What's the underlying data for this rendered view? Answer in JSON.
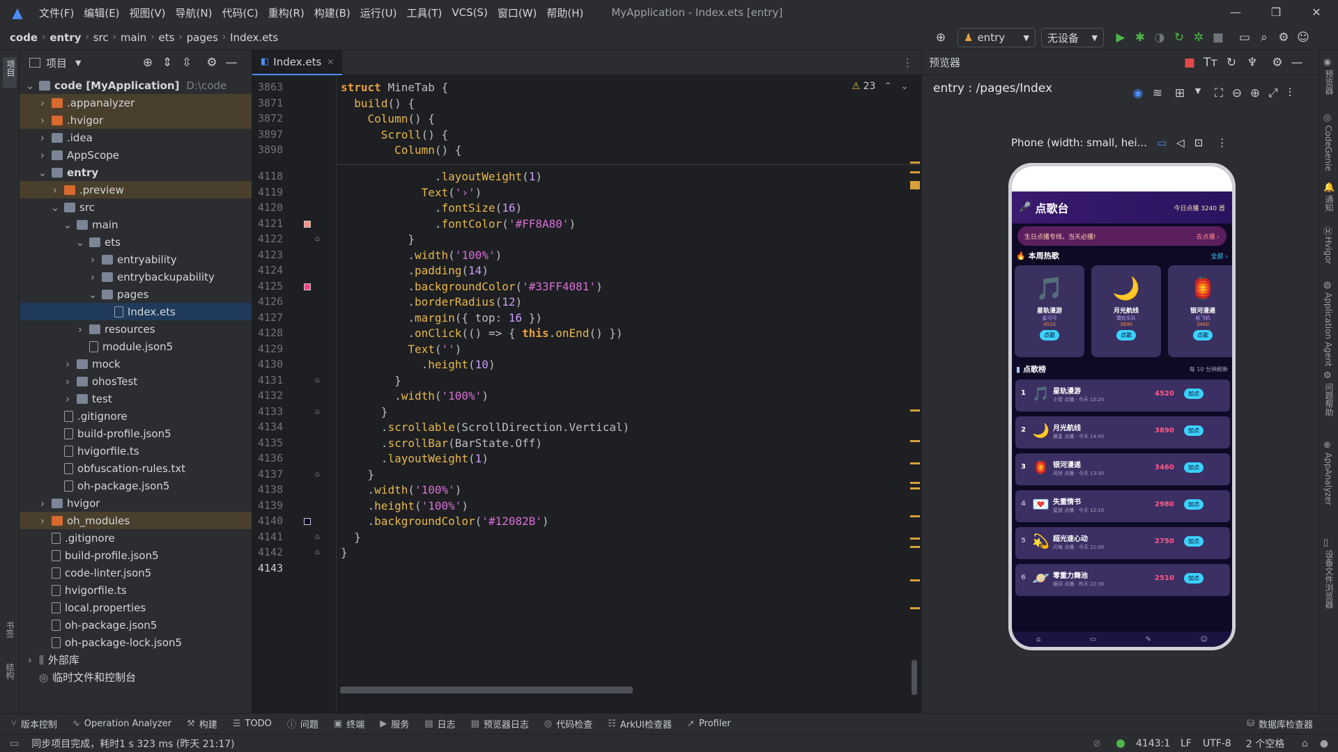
{
  "menubar": {
    "items": [
      "文件(F)",
      "编辑(E)",
      "视图(V)",
      "导航(N)",
      "代码(C)",
      "重构(R)",
      "构建(B)",
      "运行(U)",
      "工具(T)",
      "VCS(S)",
      "窗口(W)",
      "帮助(H)"
    ],
    "title": "MyApplication - Index.ets [entry]"
  },
  "breadcrumb": [
    "code",
    "entry",
    "src",
    "main",
    "ets",
    "pages",
    "Index.ets"
  ],
  "toolbar": {
    "run_config": "entry",
    "device": "无设备"
  },
  "project_panel": {
    "title": "项目"
  },
  "tree": [
    {
      "label": "code [MyApplication]",
      "path": "D:\\code",
      "depth": 0,
      "chev": "v",
      "icon": "folder",
      "hl": false,
      "bold": true
    },
    {
      "label": ".appanalyzer",
      "depth": 1,
      "chev": ">",
      "icon": "folder-or",
      "hl": true
    },
    {
      "label": ".hvigor",
      "depth": 1,
      "chev": ">",
      "icon": "folder-or",
      "hl": true
    },
    {
      "label": ".idea",
      "depth": 1,
      "chev": ">",
      "icon": "folder"
    },
    {
      "label": "AppScope",
      "depth": 1,
      "chev": ">",
      "icon": "folder"
    },
    {
      "label": "entry",
      "depth": 1,
      "chev": "v",
      "icon": "folder",
      "bold": true
    },
    {
      "label": ".preview",
      "depth": 2,
      "chev": ">",
      "icon": "folder-or",
      "hl": true
    },
    {
      "label": "src",
      "depth": 2,
      "chev": "v",
      "icon": "folder"
    },
    {
      "label": "main",
      "depth": 3,
      "chev": "v",
      "icon": "folder"
    },
    {
      "label": "ets",
      "depth": 4,
      "chev": "v",
      "icon": "folder"
    },
    {
      "label": "entryability",
      "depth": 5,
      "chev": ">",
      "icon": "folder"
    },
    {
      "label": "entrybackupability",
      "depth": 5,
      "chev": ">",
      "icon": "folder"
    },
    {
      "label": "pages",
      "depth": 5,
      "chev": "v",
      "icon": "folder"
    },
    {
      "label": "Index.ets",
      "depth": 6,
      "chev": "",
      "icon": "file",
      "sel": true
    },
    {
      "label": "resources",
      "depth": 4,
      "chev": ">",
      "icon": "folder"
    },
    {
      "label": "module.json5",
      "depth": 4,
      "chev": "",
      "icon": "file"
    },
    {
      "label": "mock",
      "depth": 3,
      "chev": ">",
      "icon": "folder"
    },
    {
      "label": "ohosTest",
      "depth": 3,
      "chev": ">",
      "icon": "folder"
    },
    {
      "label": "test",
      "depth": 3,
      "chev": ">",
      "icon": "folder"
    },
    {
      "label": ".gitignore",
      "depth": 2,
      "chev": "",
      "icon": "file"
    },
    {
      "label": "build-profile.json5",
      "depth": 2,
      "chev": "",
      "icon": "file"
    },
    {
      "label": "hvigorfile.ts",
      "depth": 2,
      "chev": "",
      "icon": "file"
    },
    {
      "label": "obfuscation-rules.txt",
      "depth": 2,
      "chev": "",
      "icon": "file"
    },
    {
      "label": "oh-package.json5",
      "depth": 2,
      "chev": "",
      "icon": "file"
    },
    {
      "label": "hvigor",
      "depth": 1,
      "chev": ">",
      "icon": "folder"
    },
    {
      "label": "oh_modules",
      "depth": 1,
      "chev": ">",
      "icon": "folder-or",
      "hl": true
    },
    {
      "label": ".gitignore",
      "depth": 1,
      "chev": "",
      "icon": "file"
    },
    {
      "label": "build-profile.json5",
      "depth": 1,
      "chev": "",
      "icon": "file"
    },
    {
      "label": "code-linter.json5",
      "depth": 1,
      "chev": "",
      "icon": "file"
    },
    {
      "label": "hvigorfile.ts",
      "depth": 1,
      "chev": "",
      "icon": "file"
    },
    {
      "label": "local.properties",
      "depth": 1,
      "chev": "",
      "icon": "file"
    },
    {
      "label": "oh-package.json5",
      "depth": 1,
      "chev": "",
      "icon": "file"
    },
    {
      "label": "oh-package-lock.json5",
      "depth": 1,
      "chev": "",
      "icon": "file"
    },
    {
      "label": "外部库",
      "depth": 0,
      "chev": ">",
      "icon": "lib"
    },
    {
      "label": "临时文件和控制台",
      "depth": 0,
      "chev": "",
      "icon": "scratch"
    }
  ],
  "editor": {
    "tab": "Index.ets",
    "warnings": "23",
    "sticky": [
      {
        "n": "3863",
        "tokens": [
          [
            "kw",
            "struct "
          ],
          [
            "plain",
            "MineTab {"
          ]
        ]
      },
      {
        "n": "3871",
        "tokens": [
          [
            "plain",
            "  "
          ],
          [
            "fn",
            "build"
          ],
          [
            "plain",
            "() {"
          ]
        ]
      },
      {
        "n": "3872",
        "tokens": [
          [
            "plain",
            "    "
          ],
          [
            "fn",
            "Column"
          ],
          [
            "plain",
            "() {"
          ]
        ]
      },
      {
        "n": "3897",
        "tokens": [
          [
            "plain",
            "      "
          ],
          [
            "fn",
            "Scroll"
          ],
          [
            "plain",
            "() {"
          ]
        ]
      },
      {
        "n": "3898",
        "tokens": [
          [
            "plain",
            "        "
          ],
          [
            "fn",
            "Column"
          ],
          [
            "plain",
            "() {"
          ]
        ]
      }
    ],
    "lines": [
      {
        "n": "4118",
        "tokens": [
          [
            "plain",
            "              ."
          ],
          [
            "fn",
            "layoutWeight"
          ],
          [
            "plain",
            "("
          ],
          [
            "num",
            "1"
          ],
          [
            "plain",
            ")"
          ]
        ]
      },
      {
        "n": "4119",
        "tokens": [
          [
            "plain",
            "            "
          ],
          [
            "fn",
            "Text"
          ],
          [
            "plain",
            "("
          ],
          [
            "str",
            "'›'"
          ],
          [
            "plain",
            ")"
          ]
        ]
      },
      {
        "n": "4120",
        "tokens": [
          [
            "plain",
            "              ."
          ],
          [
            "fn",
            "fontSize"
          ],
          [
            "plain",
            "("
          ],
          [
            "num",
            "16"
          ],
          [
            "plain",
            ")"
          ]
        ]
      },
      {
        "n": "4121",
        "tokens": [
          [
            "plain",
            "              ."
          ],
          [
            "fn",
            "fontColor"
          ],
          [
            "plain",
            "("
          ],
          [
            "str",
            "'#FF8A80'"
          ],
          [
            "plain",
            ")"
          ]
        ]
      },
      {
        "n": "4122",
        "tokens": [
          [
            "plain",
            "          }"
          ]
        ]
      },
      {
        "n": "4123",
        "tokens": [
          [
            "plain",
            "          ."
          ],
          [
            "fn",
            "width"
          ],
          [
            "plain",
            "("
          ],
          [
            "str",
            "'100%'"
          ],
          [
            "plain",
            ")"
          ]
        ]
      },
      {
        "n": "4124",
        "tokens": [
          [
            "plain",
            "          ."
          ],
          [
            "fn",
            "padding"
          ],
          [
            "plain",
            "("
          ],
          [
            "num",
            "14"
          ],
          [
            "plain",
            ")"
          ]
        ]
      },
      {
        "n": "4125",
        "tokens": [
          [
            "plain",
            "          ."
          ],
          [
            "fn",
            "backgroundColor"
          ],
          [
            "plain",
            "("
          ],
          [
            "str",
            "'#33FF4081'"
          ],
          [
            "plain",
            ")"
          ]
        ]
      },
      {
        "n": "4126",
        "tokens": [
          [
            "plain",
            "          ."
          ],
          [
            "fn",
            "borderRadius"
          ],
          [
            "plain",
            "("
          ],
          [
            "num",
            "12"
          ],
          [
            "plain",
            ")"
          ]
        ]
      },
      {
        "n": "4127",
        "tokens": [
          [
            "plain",
            "          ."
          ],
          [
            "fn",
            "margin"
          ],
          [
            "plain",
            "({ top: "
          ],
          [
            "num",
            "16"
          ],
          [
            "plain",
            " })"
          ]
        ]
      },
      {
        "n": "4128",
        "tokens": [
          [
            "plain",
            "          ."
          ],
          [
            "fn",
            "onClick"
          ],
          [
            "plain",
            "(() => { "
          ],
          [
            "kw",
            "this"
          ],
          [
            "plain",
            "."
          ],
          [
            "fn",
            "onEnd"
          ],
          [
            "plain",
            "() })"
          ]
        ]
      },
      {
        "n": "4129",
        "tokens": [
          [
            "plain",
            "          "
          ],
          [
            "fn",
            "Text"
          ],
          [
            "plain",
            "("
          ],
          [
            "str",
            "''"
          ],
          [
            "plain",
            ")"
          ]
        ]
      },
      {
        "n": "4130",
        "tokens": [
          [
            "plain",
            "            ."
          ],
          [
            "fn",
            "height"
          ],
          [
            "plain",
            "("
          ],
          [
            "num",
            "10"
          ],
          [
            "plain",
            ")"
          ]
        ]
      },
      {
        "n": "4131",
        "tokens": [
          [
            "plain",
            "        }"
          ]
        ]
      },
      {
        "n": "4132",
        "tokens": [
          [
            "plain",
            "        ."
          ],
          [
            "fn",
            "width"
          ],
          [
            "plain",
            "("
          ],
          [
            "str",
            "'100%'"
          ],
          [
            "plain",
            ")"
          ]
        ]
      },
      {
        "n": "4133",
        "tokens": [
          [
            "plain",
            "      }"
          ]
        ]
      },
      {
        "n": "4134",
        "tokens": [
          [
            "plain",
            "      ."
          ],
          [
            "fn",
            "scrollable"
          ],
          [
            "plain",
            "(ScrollDirection.Vertical)"
          ]
        ]
      },
      {
        "n": "4135",
        "tokens": [
          [
            "plain",
            "      ."
          ],
          [
            "fn",
            "scrollBar"
          ],
          [
            "plain",
            "(BarState.Off)"
          ]
        ]
      },
      {
        "n": "4136",
        "tokens": [
          [
            "plain",
            "      ."
          ],
          [
            "fn",
            "layoutWeight"
          ],
          [
            "plain",
            "("
          ],
          [
            "num",
            "1"
          ],
          [
            "plain",
            ")"
          ]
        ]
      },
      {
        "n": "4137",
        "tokens": [
          [
            "plain",
            "    }"
          ]
        ]
      },
      {
        "n": "4138",
        "tokens": [
          [
            "plain",
            "    ."
          ],
          [
            "fn",
            "width"
          ],
          [
            "plain",
            "("
          ],
          [
            "str",
            "'100%'"
          ],
          [
            "plain",
            ")"
          ]
        ]
      },
      {
        "n": "4139",
        "tokens": [
          [
            "plain",
            "    ."
          ],
          [
            "fn",
            "height"
          ],
          [
            "plain",
            "("
          ],
          [
            "str",
            "'100%'"
          ],
          [
            "plain",
            ")"
          ]
        ]
      },
      {
        "n": "4140",
        "tokens": [
          [
            "plain",
            "    ."
          ],
          [
            "fn",
            "backgroundColor"
          ],
          [
            "plain",
            "("
          ],
          [
            "str",
            "'#12082B'"
          ],
          [
            "plain",
            ")"
          ]
        ]
      },
      {
        "n": "4141",
        "tokens": [
          [
            "plain",
            "  }"
          ]
        ]
      },
      {
        "n": "4142",
        "tokens": [
          [
            "plain",
            "}"
          ]
        ]
      },
      {
        "n": "4143",
        "tokens": []
      }
    ]
  },
  "preview": {
    "title": "预览器",
    "route": "entry : /pages/Index",
    "device": "Phone (width: small, hei...",
    "app": {
      "header": "点歌台",
      "today": "今日点播 3240 首",
      "banner": "生日点播专线，当天必播!",
      "banner_action": "去点播 ›",
      "hot_title": "本周热歌",
      "hot_more": "全部 ›",
      "cards": [
        {
          "name": "星轨漫游",
          "artist": "星可可",
          "count": "4520",
          "btn": "点歌",
          "glyph": "🎵"
        },
        {
          "name": "月光航线",
          "artist": "霓虹乐队",
          "count": "3890",
          "btn": "点歌",
          "glyph": "🌙"
        },
        {
          "name": "银河漫递",
          "artist": "纸飞机",
          "count": "3460",
          "btn": "点歌",
          "glyph": "🏮"
        }
      ],
      "rank_title": "点歌榜",
      "rank_note": "每 10 分钟刷新",
      "rank": [
        {
          "n": "1",
          "name": "星轨漫游",
          "sub": "小雪 点播 · 今天 15:20",
          "count": "4520",
          "glyph": "🎵"
        },
        {
          "n": "2",
          "name": "月光航线",
          "sub": "晨星 点播 · 今天 14:45",
          "count": "3890",
          "glyph": "🌙"
        },
        {
          "n": "3",
          "name": "银河漫递",
          "sub": "风铃 点播 · 今天 13:30",
          "count": "3460",
          "glyph": "🏮"
        },
        {
          "n": "4",
          "name": "失重情书",
          "sub": "星旅 点播 · 今天 12:10",
          "count": "2980",
          "glyph": "💌"
        },
        {
          "n": "5",
          "name": "超光速心动",
          "sub": "闪电 点播 · 今天 11:00",
          "count": "2750",
          "glyph": "💫"
        },
        {
          "n": "6",
          "name": "零重力舞池",
          "sub": "银河 点播 · 昨天 22:30",
          "count": "2510",
          "glyph": "🪐"
        }
      ],
      "rank_btn": "加点"
    }
  },
  "left_vertical": [
    "项目",
    "书签",
    "结构"
  ],
  "right_vertical": [
    "预览器",
    "CodeGenie",
    "通知",
    "Hvigor",
    "Application Agent",
    "问题帮助",
    "AppAnalyzer",
    "设备文件浏览器"
  ],
  "bottom_tools": [
    {
      "icon": "⑂",
      "label": "版本控制"
    },
    {
      "icon": "∿",
      "label": "Operation Analyzer"
    },
    {
      "icon": "⚒",
      "label": "构建"
    },
    {
      "icon": "☰",
      "label": "TODO"
    },
    {
      "icon": "ⓘ",
      "label": "问题"
    },
    {
      "icon": "▣",
      "label": "终端"
    },
    {
      "icon": "▶",
      "label": "服务"
    },
    {
      "icon": "▤",
      "label": "日志"
    },
    {
      "icon": "▤",
      "label": "预览器日志"
    },
    {
      "icon": "◎",
      "label": "代码检查"
    },
    {
      "icon": "☷",
      "label": "ArkUI检查器"
    },
    {
      "icon": "➚",
      "label": "Profiler"
    }
  ],
  "db_inspector": "数据库检查器",
  "status": {
    "message": "同步项目完成，耗时1 s 323 ms (昨天 21:17)",
    "position": "4143:1",
    "line_sep": "LF",
    "encoding": "UTF-8",
    "indent": "2 个空格"
  },
  "colors": {
    "accent": "#4c8dff",
    "highlight": "#4a3f2c",
    "selection": "#1f3a5c",
    "editor_bg": "#1e1f22"
  }
}
